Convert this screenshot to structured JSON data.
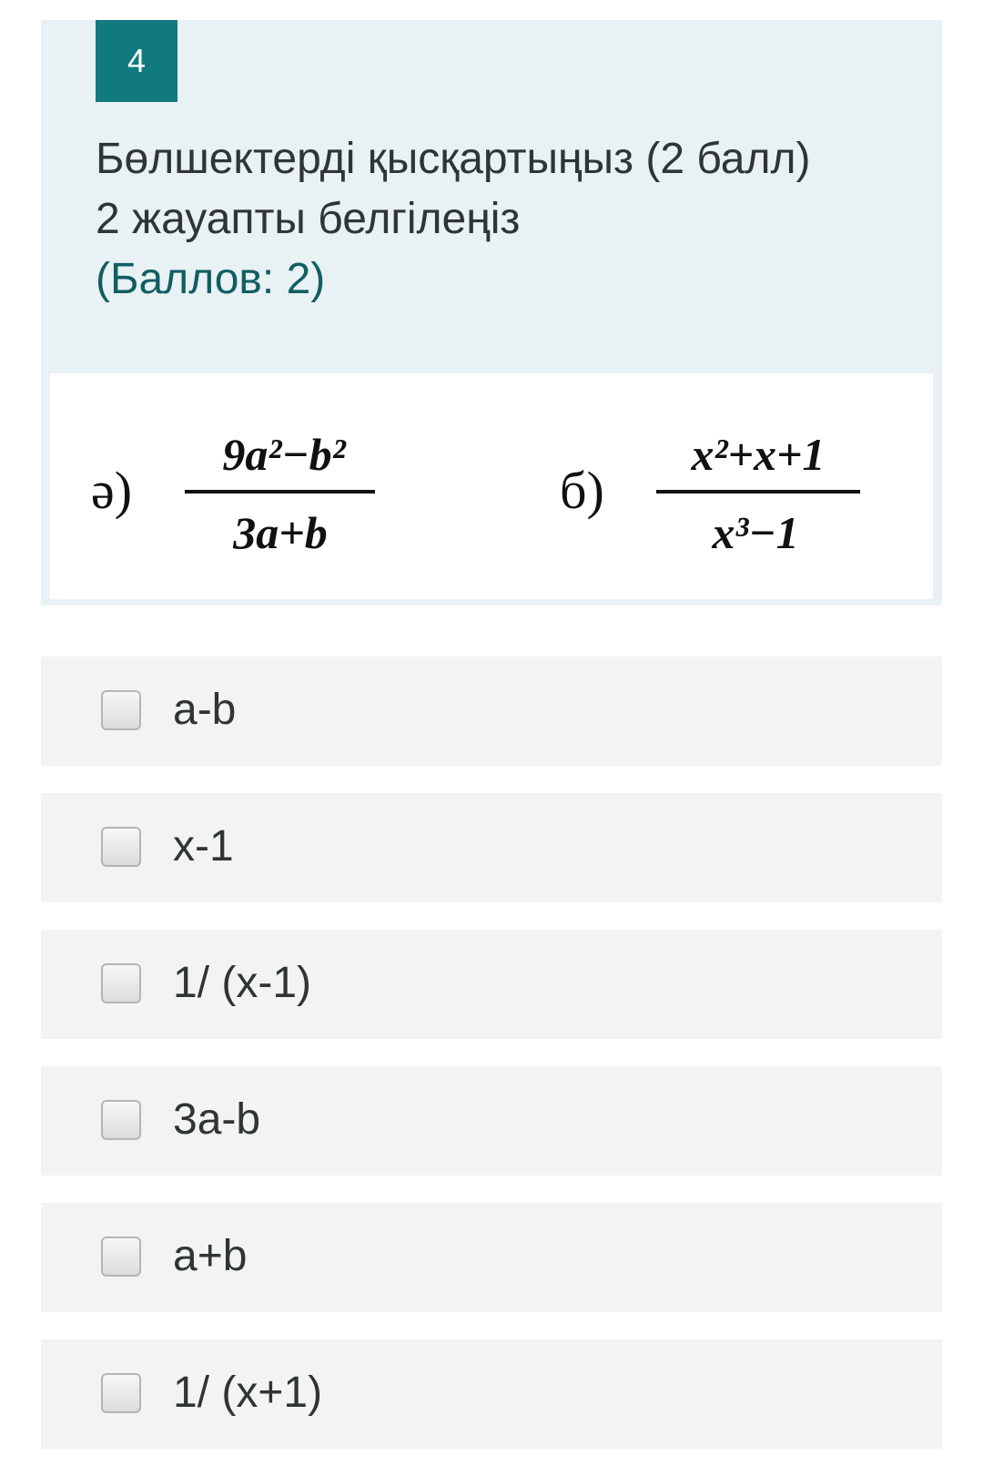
{
  "question": {
    "number": "4",
    "text": "Бөлшектерді қысқартыңыз (2 балл) 2 жауапты белгілеңіз",
    "points": "(Баллов: 2)"
  },
  "formulas": {
    "a": {
      "label": "ә)",
      "numerator": "9a²−b²",
      "denominator": "3a+b"
    },
    "b": {
      "label": "б)",
      "numerator": "x²+x+1",
      "denominator": "x³−1"
    }
  },
  "answers": [
    {
      "label": "a-b",
      "checked": false
    },
    {
      "label": "x-1",
      "checked": false
    },
    {
      "label": "1/ (x-1)",
      "checked": false
    },
    {
      "label": "3a-b",
      "checked": false
    },
    {
      "label": "a+b",
      "checked": false
    },
    {
      "label": "1/ (x+1)",
      "checked": false
    }
  ],
  "colors": {
    "accent": "#117a7e",
    "card_bg": "#e8f1f4",
    "answer_bg": "#f3f3f3",
    "points_text": "#115e62"
  }
}
